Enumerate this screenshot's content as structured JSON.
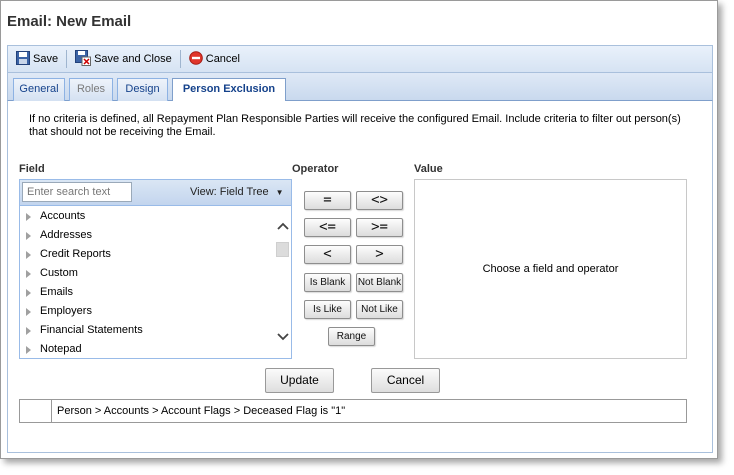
{
  "window": {
    "title": "Email: New Email"
  },
  "toolbar": {
    "save_label": "Save",
    "save_close_label": "Save and Close",
    "cancel_label": "Cancel"
  },
  "tabs": [
    {
      "label": "General",
      "state": "enabled"
    },
    {
      "label": "Roles",
      "state": "disabled"
    },
    {
      "label": "Design",
      "state": "enabled"
    },
    {
      "label": "Person Exclusion",
      "state": "active"
    }
  ],
  "info_text": "If no criteria is defined, all Repayment Plan Responsible Parties will receive the configured Email. Include criteria to filter out person(s) that should not be receiving the Email.",
  "field": {
    "label": "Field",
    "search_placeholder": "Enter search text",
    "view_label": "View: Field Tree",
    "tree_items": [
      "Accounts",
      "Addresses",
      "Credit Reports",
      "Custom",
      "Emails",
      "Employers",
      "Financial Statements",
      "Notepad"
    ]
  },
  "operator": {
    "label": "Operator",
    "buttons": [
      "=",
      "<>",
      "<=",
      ">=",
      "<",
      ">",
      "Is Blank",
      "Not Blank",
      "Is Like",
      "Not Like",
      "Range"
    ]
  },
  "value": {
    "label": "Value",
    "placeholder_text": "Choose a field and operator"
  },
  "actions": {
    "update_label": "Update",
    "cancel_label": "Cancel"
  },
  "criteria": {
    "text": "Person > Accounts > Account Flags > Deceased Flag is \"1\""
  },
  "colors": {
    "accent": "#15428b",
    "toolbar_bg": "#d6e3f3",
    "border": "#99bbe8"
  }
}
